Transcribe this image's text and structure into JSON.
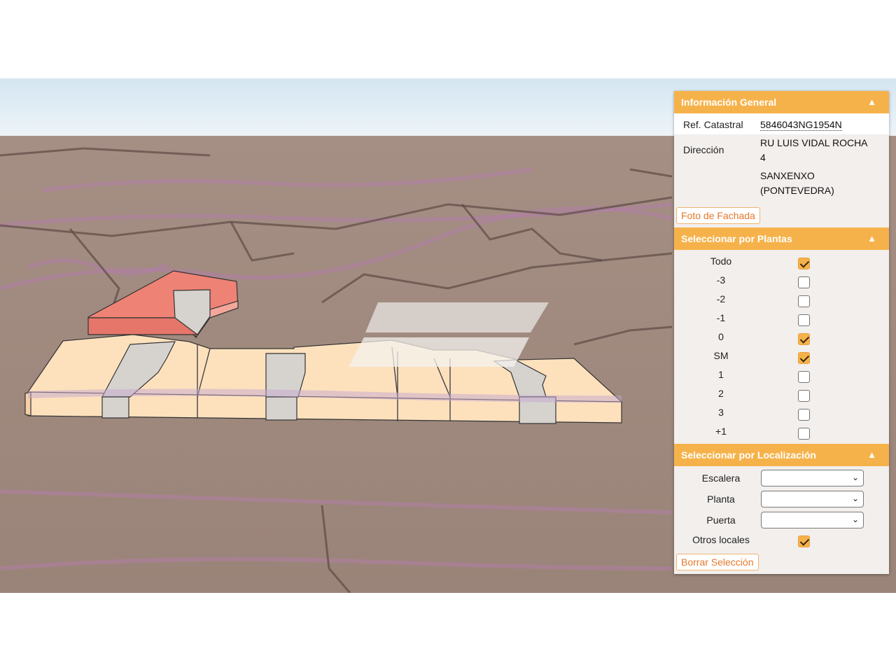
{
  "info_general": {
    "title": "Información General",
    "ref_label": "Ref. Catastral",
    "ref_value": "5846043NG1954N",
    "direccion_label": "Dirección",
    "direccion_line1": "RU LUIS VIDAL ROCHA",
    "direccion_line2": "4",
    "direccion_line3": "SANXENXO",
    "direccion_line4": "(PONTEVEDRA)",
    "foto_button": "Foto de Fachada"
  },
  "plantas": {
    "title": "Seleccionar por Plantas",
    "items": [
      {
        "label": "Todo",
        "checked": true
      },
      {
        "label": "-3",
        "checked": false
      },
      {
        "label": "-2",
        "checked": false
      },
      {
        "label": "-1",
        "checked": false
      },
      {
        "label": "0",
        "checked": true
      },
      {
        "label": "SM",
        "checked": true
      },
      {
        "label": "1",
        "checked": false
      },
      {
        "label": "2",
        "checked": false
      },
      {
        "label": "3",
        "checked": false
      },
      {
        "label": "+1",
        "checked": false
      }
    ]
  },
  "localizacion": {
    "title": "Seleccionar por Localización",
    "escalera_label": "Escalera",
    "planta_label": "Planta",
    "puerta_label": "Puerta",
    "otros_label": "Otros locales",
    "otros_checked": true,
    "borrar_button": "Borrar Selección"
  },
  "collapse_icon": "triangle-up-icon",
  "colors": {
    "header": "#f6b24a",
    "button_text": "#e4782c",
    "ground": "#9d857a",
    "sky": "#d9e9f3",
    "building_base": "#fde1bd",
    "building_highlight": "#ee8275",
    "common_zone": "#d6d3cf"
  }
}
